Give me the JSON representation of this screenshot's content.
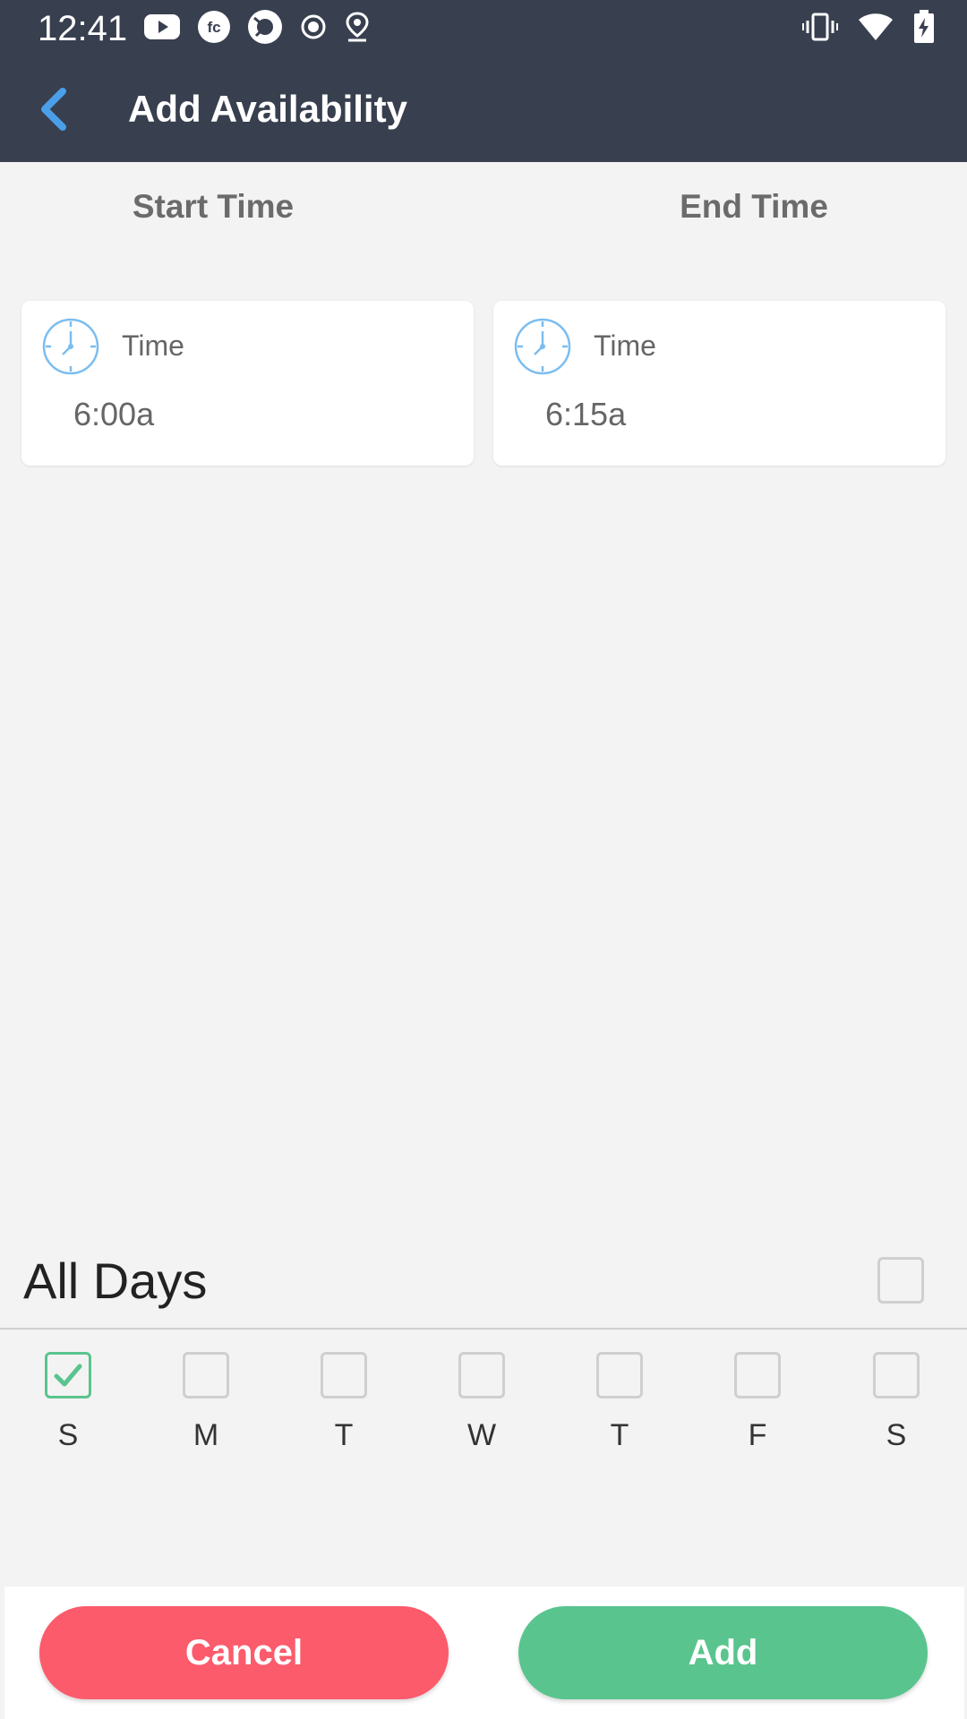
{
  "status_bar": {
    "time": "12:41",
    "left_icons": [
      "youtube-icon",
      "fc-app-icon",
      "camera-app-icon",
      "record-icon",
      "location-icon"
    ],
    "right_icons": [
      "vibrate-icon",
      "wifi-icon",
      "battery-charging-icon"
    ]
  },
  "header": {
    "title": "Add Availability",
    "back_icon": "chevron-left-icon"
  },
  "columns": {
    "start_label": "Start Time",
    "end_label": "End Time"
  },
  "start_card": {
    "label": "Time",
    "value": "6:00a"
  },
  "end_card": {
    "label": "Time",
    "value": "6:15a"
  },
  "all_days": {
    "label": "All Days",
    "checked": false
  },
  "days": [
    {
      "label": "S",
      "checked": true
    },
    {
      "label": "M",
      "checked": false
    },
    {
      "label": "T",
      "checked": false
    },
    {
      "label": "W",
      "checked": false
    },
    {
      "label": "T",
      "checked": false
    },
    {
      "label": "F",
      "checked": false
    },
    {
      "label": "S",
      "checked": false
    }
  ],
  "footer": {
    "cancel_label": "Cancel",
    "add_label": "Add"
  },
  "colors": {
    "header_bg": "#383f4f",
    "accent_blue": "#4a9fe8",
    "cancel_red": "#fc5b6c",
    "add_green": "#5ac48e"
  }
}
